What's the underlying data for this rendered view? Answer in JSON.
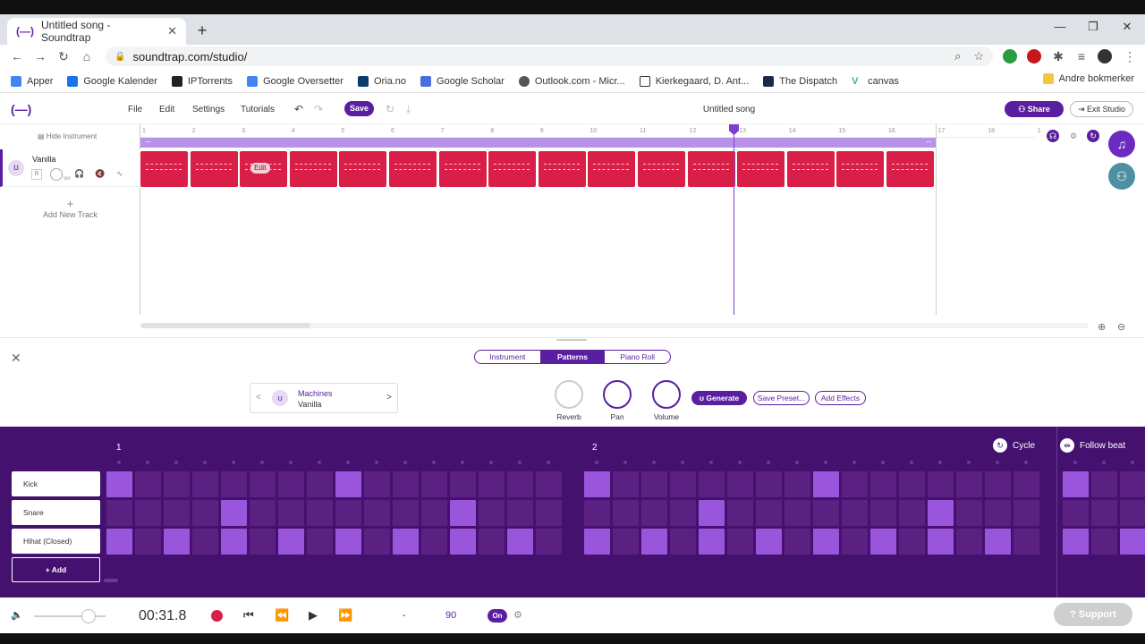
{
  "browser": {
    "tab_title": "Untitled song - Soundtrap",
    "tab_favicon": "(—)",
    "new_tab": "+",
    "url": "soundtrap.com/studio/",
    "bookmarks": [
      "Apper",
      "Google Kalender",
      "IPTorrents",
      "Google Oversetter",
      "Oria.no",
      "Google Scholar",
      "Outlook.com - Micr...",
      "Kierkegaard, D. Ant...",
      "The Dispatch",
      "canvas"
    ],
    "bookmarks_right": "Andre bokmerker"
  },
  "studio": {
    "logo": "(—)",
    "menu": [
      "File",
      "Edit",
      "Settings",
      "Tutorials"
    ],
    "save_label": "Save",
    "song_title": "Untitled song",
    "share_label": "Share",
    "exit_label": "Exit Studio",
    "hide_instrument": "Hide Instrument",
    "add_track": "Add New Track",
    "track": {
      "name": "Vanilla",
      "rec": "R",
      "vol_label": "Vol"
    },
    "ruler": [
      "1",
      "2",
      "3",
      "4",
      "5",
      "6",
      "7",
      "8",
      "9",
      "10",
      "11",
      "12",
      "13",
      "14",
      "15",
      "16",
      "17",
      "18",
      "1"
    ],
    "clip_count": 16,
    "edit_badge": "Edit"
  },
  "panel": {
    "tabs": [
      "Instrument",
      "Patterns",
      "Piano Roll"
    ],
    "active_tab": "Patterns",
    "preset_category": "Machines",
    "preset_name": "Vanilla",
    "knobs": [
      "Reverb",
      "Pan",
      "Volume"
    ],
    "generate_label": "Generate",
    "save_preset_label": "Save Preset...",
    "add_effects_label": "Add Effects"
  },
  "sequencer": {
    "bars": [
      "1",
      "2"
    ],
    "cycle_label": "Cycle",
    "follow_label": "Follow beat",
    "rows": [
      {
        "name": "Kick",
        "steps": [
          1,
          0,
          0,
          0,
          0,
          0,
          0,
          0,
          1,
          0,
          0,
          0,
          0,
          0,
          0,
          0,
          1,
          0,
          0,
          0,
          0,
          0,
          0,
          0,
          1,
          0,
          0,
          0,
          0,
          0,
          0,
          0,
          1,
          0,
          0
        ]
      },
      {
        "name": "Snare",
        "steps": [
          0,
          0,
          0,
          0,
          1,
          0,
          0,
          0,
          0,
          0,
          0,
          0,
          1,
          0,
          0,
          0,
          0,
          0,
          0,
          0,
          1,
          0,
          0,
          0,
          0,
          0,
          0,
          0,
          1,
          0,
          0,
          0,
          0,
          0,
          0
        ]
      },
      {
        "name": "Hihat (Closed)",
        "steps": [
          1,
          0,
          1,
          0,
          1,
          0,
          1,
          0,
          1,
          0,
          1,
          0,
          1,
          0,
          1,
          0,
          1,
          0,
          1,
          0,
          1,
          0,
          1,
          0,
          1,
          0,
          1,
          0,
          1,
          0,
          1,
          0,
          1,
          0,
          1
        ]
      }
    ],
    "add_label": "+ Add"
  },
  "transport": {
    "time": "00:31.8",
    "dash": "-",
    "bpm": "90",
    "metronome": "On",
    "support_label": "Support"
  },
  "colors": {
    "accent": "#5a1ea0",
    "clip": "#d91e48",
    "seq_bg": "#44126e",
    "step_on": "#9a55dd"
  }
}
